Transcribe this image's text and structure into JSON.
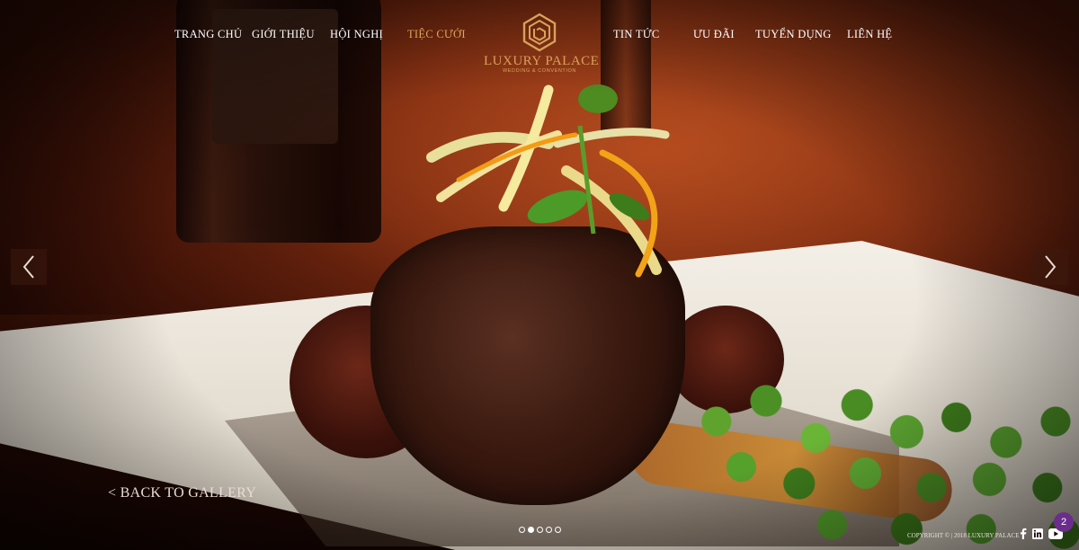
{
  "nav": {
    "items": [
      {
        "label": "TRANG CHỦ"
      },
      {
        "label": "GIỚI THIỆU"
      },
      {
        "label": "HỘI NGHỊ"
      },
      {
        "label": "TIỆC CƯỚI",
        "active": true
      },
      {
        "label": "TIN TỨC"
      },
      {
        "label": "ƯU ĐÃI"
      },
      {
        "label": "TUYỂN DỤNG"
      },
      {
        "label": "LIÊN HỆ"
      }
    ],
    "active_color": "#e0a55b"
  },
  "logo": {
    "brand": "LUXURY PALACE",
    "tagline": "WEDDING & CONVENTION",
    "icon": "hexagon-logo-icon",
    "color": "#d8a25a"
  },
  "slider": {
    "prev_icon": "chevron-left-icon",
    "next_icon": "chevron-right-icon",
    "slide_count": 5,
    "active_index": 1
  },
  "back_link": {
    "label": "< BACK TO GALLERY"
  },
  "footer": {
    "copyright": "COPYRIGHT © | 2018 LUXURY PALACE",
    "socials": [
      "facebook-icon",
      "linkedin-icon",
      "youtube-icon"
    ]
  },
  "notification_badge": {
    "count": "2",
    "color": "#6b2d8b"
  }
}
